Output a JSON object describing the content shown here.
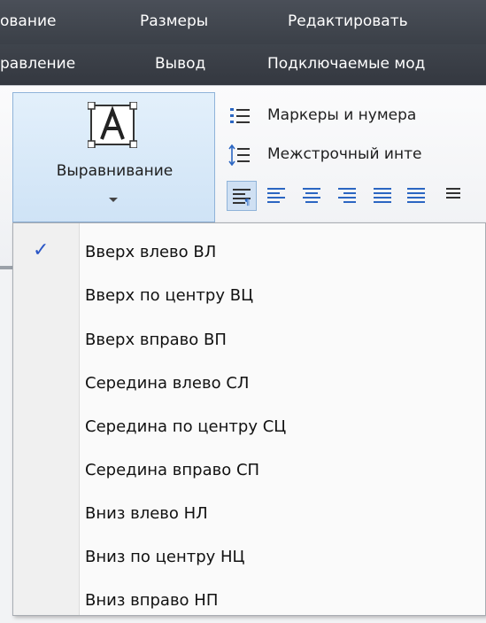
{
  "menubar_top": {
    "items": [
      "ование",
      "Размеры",
      "Редактировать"
    ]
  },
  "menubar_second": {
    "items": [
      "равление",
      "Вывод",
      "Подключаемые мод"
    ]
  },
  "ribbon": {
    "align_button_label": "Выравнивание",
    "bullets_label": "Маркеры и нумера",
    "line_spacing_label": "Межстрочный инте"
  },
  "dropdown": {
    "items": [
      {
        "label": "Вверх влево ВЛ",
        "checked": true
      },
      {
        "label": "Вверх по центру ВЦ",
        "checked": false
      },
      {
        "label": "Вверх вправо ВП",
        "checked": false
      },
      {
        "label": "Середина влево СЛ",
        "checked": false
      },
      {
        "label": "Середина по центру СЦ",
        "checked": false
      },
      {
        "label": "Середина вправо СП",
        "checked": false
      },
      {
        "label": "Вниз влево НЛ",
        "checked": false
      },
      {
        "label": "Вниз по центру НЦ",
        "checked": false
      },
      {
        "label": "Вниз вправо НП",
        "checked": false
      }
    ],
    "check_glyph": "✓"
  },
  "colors": {
    "menubar": "#3b4048",
    "selection": "#cfe3f6",
    "check": "#2a56c6"
  }
}
